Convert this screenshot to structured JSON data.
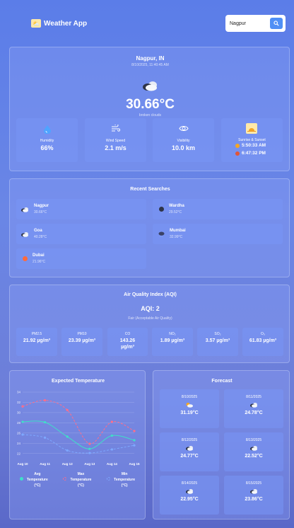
{
  "app": {
    "title": "Weather App",
    "logo_icon": "sun-cloud-icon"
  },
  "search": {
    "value": "Nagpur",
    "button_icon": "search-icon"
  },
  "current": {
    "city": "Nagpur, IN",
    "datetime": "8/10/2025, 11:40:45 AM",
    "temperature": "30.66°C",
    "description": "broken clouds",
    "icon": "broken-clouds-icon",
    "metrics": [
      {
        "label": "Humidity",
        "value": "66%",
        "icon": "droplet-icon"
      },
      {
        "label": "Wind Speed",
        "value": "2.1 m/s",
        "icon": "wind-icon"
      },
      {
        "label": "Visibility",
        "value": "10.0 km",
        "icon": "eye-icon"
      }
    ],
    "sun": {
      "label": "Sunrise & Sunset",
      "sunrise": "5:50:33 AM",
      "sunset": "6:47:32 PM",
      "icon": "sunrise-icon"
    }
  },
  "recent": {
    "title": "Recent Searches",
    "items": [
      {
        "city": "Nagpur",
        "temp": "30.66°C",
        "icon": "broken-clouds-icon"
      },
      {
        "city": "Wardha",
        "temp": "29.52°C",
        "icon": "overcast-icon"
      },
      {
        "city": "Goa",
        "temp": "40.28°C",
        "icon": "broken-clouds-icon"
      },
      {
        "city": "Mumbai",
        "temp": "32.99°C",
        "icon": "rain-icon"
      },
      {
        "city": "Dubai",
        "temp": "21.96°C",
        "icon": "clear-sky-icon"
      }
    ]
  },
  "aqi": {
    "title": "Air Quality Index (AQI)",
    "value": "AQI: 2",
    "status": "Fair (Acceptable Air Quality)",
    "pollutants": [
      {
        "label": "PM2.5",
        "value": "21.92 µg/m³"
      },
      {
        "label": "PM10",
        "value": "23.39 µg/m³"
      },
      {
        "label": "CO",
        "value": "143.26 µg/m³"
      },
      {
        "label": "NO₂",
        "value": "1.89 µg/m³"
      },
      {
        "label": "SO₂",
        "value": "3.57 µg/m³"
      },
      {
        "label": "O₃",
        "value": "61.83 µg/m³"
      }
    ]
  },
  "chart": {
    "title": "Expected Temperature",
    "legend": [
      "Avg Temperature (°C)",
      "Max Temperature (°C)",
      "Min Temperature (°C)"
    ]
  },
  "chart_data": {
    "type": "line",
    "title": "Expected Temperature",
    "x": [
      "Aug 10",
      "Aug 11",
      "Aug 12",
      "Aug 13",
      "Aug 14",
      "Aug 15"
    ],
    "y_ticks": [
      34,
      32,
      30,
      28,
      26,
      24,
      22
    ],
    "ylim": [
      21,
      34
    ],
    "series": [
      {
        "name": "Avg Temperature (°C)",
        "color": "#3fe0c8",
        "values": [
          28.2,
          28.1,
          25.3,
          22.9,
          25.5,
          24.6
        ]
      },
      {
        "name": "Max Temperature (°C)",
        "color": "#ff6d8a",
        "values": [
          31.2,
          32.4,
          30.5,
          23.9,
          28.2,
          26.4
        ]
      },
      {
        "name": "Min Temperature (°C)",
        "color": "#7ea8ff",
        "values": [
          25.7,
          25.1,
          22.6,
          22.1,
          22.8,
          23.6
        ]
      }
    ],
    "legend": "bottom",
    "grid": true
  },
  "forecast": {
    "title": "Forecast",
    "items": [
      {
        "date": "8/10/2025",
        "temp": "31.19°C",
        "icon": "scattered-clouds-icon"
      },
      {
        "date": "8/11/2025",
        "temp": "24.78°C",
        "icon": "broken-clouds-icon"
      },
      {
        "date": "8/12/2025",
        "temp": "24.77°C",
        "icon": "broken-clouds-icon"
      },
      {
        "date": "8/13/2025",
        "temp": "22.52°C",
        "icon": "broken-clouds-icon"
      },
      {
        "date": "8/14/2025",
        "temp": "22.95°C",
        "icon": "broken-clouds-icon"
      },
      {
        "date": "8/15/2025",
        "temp": "23.86°C",
        "icon": "broken-clouds-icon"
      }
    ]
  }
}
